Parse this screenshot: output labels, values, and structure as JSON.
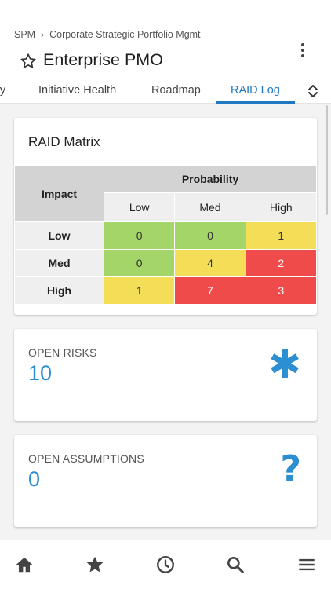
{
  "breadcrumb": {
    "root": "SPM",
    "separator": "›",
    "current": "Corporate Strategic Portfolio Mgmt"
  },
  "header": {
    "title": "Enterprise PMO",
    "star_icon": "star-outline-icon",
    "menu_icon": "more-vertical-icon"
  },
  "tabs": [
    {
      "label": "ry",
      "active": false
    },
    {
      "label": "Initiative Health",
      "active": false
    },
    {
      "label": "Roadmap",
      "active": false
    },
    {
      "label": "RAID Log",
      "active": true
    }
  ],
  "tabs_toggle_icon": "chevron-up-down-icon",
  "raid_matrix": {
    "title": "RAID Matrix",
    "row_axis_label": "Impact",
    "column_axis_label": "Probability",
    "columns": [
      "Low",
      "Med",
      "High"
    ],
    "rows": [
      {
        "label": "Low",
        "values": [
          "0",
          "0",
          "1"
        ],
        "levels": [
          "green",
          "green",
          "yellow"
        ]
      },
      {
        "label": "Med",
        "values": [
          "0",
          "4",
          "2"
        ],
        "levels": [
          "green",
          "yellow",
          "red"
        ]
      },
      {
        "label": "High",
        "values": [
          "1",
          "7",
          "3"
        ],
        "levels": [
          "yellow",
          "red",
          "red"
        ]
      }
    ],
    "colors": {
      "green": "#a3d568",
      "yellow": "#f4de57",
      "red": "#ef4b4b"
    }
  },
  "metrics": [
    {
      "label": "OPEN RISKS",
      "value": "10",
      "icon": "asterisk-icon",
      "glyph": "✱"
    },
    {
      "label": "OPEN ASSUMPTIONS",
      "value": "0",
      "icon": "question-mark-icon",
      "glyph": "?"
    }
  ],
  "bottom_nav": [
    {
      "icon": "home-icon"
    },
    {
      "icon": "star-icon"
    },
    {
      "icon": "history-clock-icon"
    },
    {
      "icon": "search-icon"
    },
    {
      "icon": "menu-icon"
    }
  ],
  "colors": {
    "accent": "#1f78c1",
    "metric_value": "#2b8fd1"
  }
}
